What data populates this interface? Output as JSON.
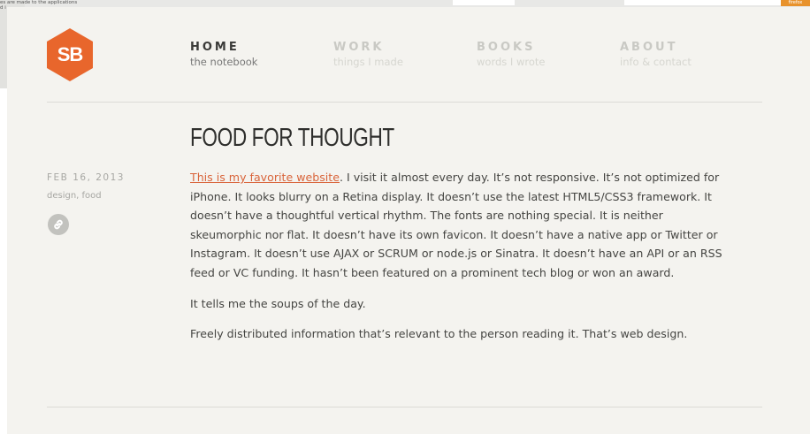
{
  "backdrop": {
    "left_text_line1": "es are made to the applications",
    "left_text_line2": "d i",
    "badge_label": "firefox",
    "badge_color": "#e8922c"
  },
  "logo": {
    "text": "SB",
    "color": "#e8662c"
  },
  "nav": [
    {
      "title": "HOME",
      "subtitle": "the notebook",
      "active": true
    },
    {
      "title": "WORK",
      "subtitle": "things I made",
      "active": false
    },
    {
      "title": "BOOKS",
      "subtitle": "words I wrote",
      "active": false
    },
    {
      "title": "ABOUT",
      "subtitle": "info & contact",
      "active": false
    }
  ],
  "post": {
    "title": "FOOD FOR THOUGHT",
    "date": "FEB 16, 2013",
    "tags": "design, food",
    "permalink_icon": "link-icon",
    "link_text": "This is my favorite website",
    "para1_rest": ". I visit it almost every day. It’s not responsive. It’s not optimized for iPhone. It looks blurry on a Retina display. It doesn’t use the latest HTML5/CSS3 framework. It doesn’t have a thoughtful vertical rhythm. The fonts are nothing special. It is neither skeumorphic nor flat. It doesn’t have its own favicon. It doesn’t have a native app or Twitter or Instagram. It doesn’t use AJAX or SCRUM or node.js or Sinatra. It doesn’t have an API or an RSS feed or VC funding. It hasn’t been featured on a prominent tech blog or won an award.",
    "para2": "It tells me the soups of the day.",
    "para3": "Freely distributed information that’s relevant to the person reading it. That’s web design."
  },
  "colors": {
    "accent": "#d9643a",
    "background": "#f4f3ef",
    "text": "#454542"
  }
}
